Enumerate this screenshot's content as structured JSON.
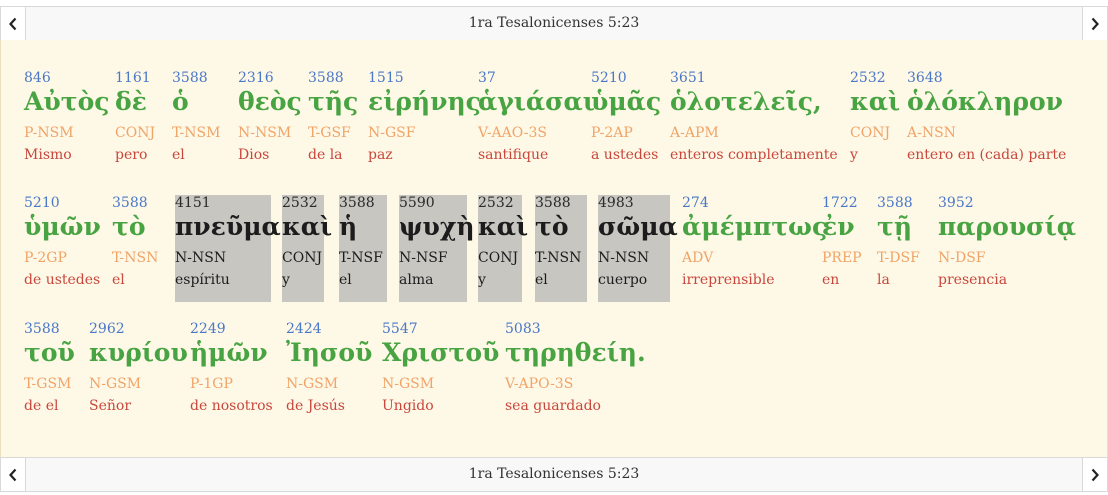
{
  "nav": {
    "title": "1ra Tesalonicenses 5:23",
    "prev_icon": "chevron-left-icon",
    "next_icon": "chevron-right-icon"
  },
  "colors": {
    "strong": "#4a78c8",
    "greek": "#48a442",
    "parse": "#f0a468",
    "gloss": "#c8473d",
    "highlight": "#c8c6c1",
    "background": "#fef8e6"
  },
  "rows": [
    [
      {
        "strong": "846",
        "greek": "Αὐτὸς",
        "parse": "P-NSM",
        "gloss": "Mismo"
      },
      {
        "strong": "1161",
        "greek": "δὲ",
        "parse": "CONJ",
        "gloss": "pero"
      },
      {
        "strong": "3588",
        "greek": "ὁ",
        "parse": "T-NSM",
        "gloss": "el"
      },
      {
        "strong": "2316",
        "greek": "θεὸς",
        "parse": "N-NSM",
        "gloss": "Dios"
      },
      {
        "strong": "3588",
        "greek": "τῆς",
        "parse": "T-GSF",
        "gloss": "de la"
      },
      {
        "strong": "1515",
        "greek": "εἰρήνης",
        "parse": "N-GSF",
        "gloss": "paz"
      },
      {
        "strong": "37",
        "greek": "ἁγιάσαι",
        "parse": "V-AAO-3S",
        "gloss": "santifique"
      },
      {
        "strong": "5210",
        "greek": "ὑμᾶς",
        "parse": "P-2AP",
        "gloss": "a ustedes"
      },
      {
        "strong": "3651",
        "greek": "ὁλοτελεῖς,",
        "parse": "A-APM",
        "gloss": "enteros completamente"
      },
      {
        "strong": "2532",
        "greek": "καὶ",
        "parse": "CONJ",
        "gloss": "y"
      },
      {
        "strong": "3648",
        "greek": "ὁλόκληρον",
        "parse": "A-NSN",
        "gloss": "entero en (cada) parte"
      }
    ],
    [
      {
        "strong": "5210",
        "greek": "ὑμῶν",
        "parse": "P-2GP",
        "gloss": "de ustedes"
      },
      {
        "strong": "3588",
        "greek": "τὸ",
        "parse": "T-NSN",
        "gloss": "el"
      },
      {
        "strong": "4151",
        "greek": "πνεῦμα",
        "parse": "N-NSN",
        "gloss": "espíritu",
        "highlight": true
      },
      {
        "strong": "2532",
        "greek": "καὶ",
        "parse": "CONJ",
        "gloss": "y",
        "highlight": true
      },
      {
        "strong": "3588",
        "greek": "ἡ",
        "parse": "T-NSF",
        "gloss": "el",
        "highlight": true
      },
      {
        "strong": "5590",
        "greek": "ψυχὴ",
        "parse": "N-NSF",
        "gloss": "alma",
        "highlight": true
      },
      {
        "strong": "2532",
        "greek": "καὶ",
        "parse": "CONJ",
        "gloss": "y",
        "highlight": true
      },
      {
        "strong": "3588",
        "greek": "τὸ",
        "parse": "T-NSN",
        "gloss": "el",
        "highlight": true
      },
      {
        "strong": "4983",
        "greek": "σῶμα",
        "parse": "N-NSN",
        "gloss": "cuerpo",
        "highlight": true
      },
      {
        "strong": "274",
        "greek": "ἀμέμπτως",
        "parse": "ADV",
        "gloss": "irreprensible"
      },
      {
        "strong": "1722",
        "greek": "ἐν",
        "parse": "PREP",
        "gloss": "en"
      },
      {
        "strong": "3588",
        "greek": "τῇ",
        "parse": "T-DSF",
        "gloss": "la"
      },
      {
        "strong": "3952",
        "greek": "παρουσίᾳ",
        "parse": "N-DSF",
        "gloss": "presencia"
      }
    ],
    [
      {
        "strong": "3588",
        "greek": "τοῦ",
        "parse": "T-GSM",
        "gloss": "de el"
      },
      {
        "strong": "2962",
        "greek": "κυρίου",
        "parse": "N-GSM",
        "gloss": "Señor"
      },
      {
        "strong": "2249",
        "greek": "ἡμῶν",
        "parse": "P-1GP",
        "gloss": "de nosotros"
      },
      {
        "strong": "2424",
        "greek": "Ἰησοῦ",
        "parse": "N-GSM",
        "gloss": "de Jesús"
      },
      {
        "strong": "5547",
        "greek": "Χριστοῦ",
        "parse": "N-GSM",
        "gloss": "Ungido"
      },
      {
        "strong": "5083",
        "greek": "τηρηθείη.",
        "parse": "V-APO-3S",
        "gloss": "sea guardado"
      }
    ]
  ]
}
